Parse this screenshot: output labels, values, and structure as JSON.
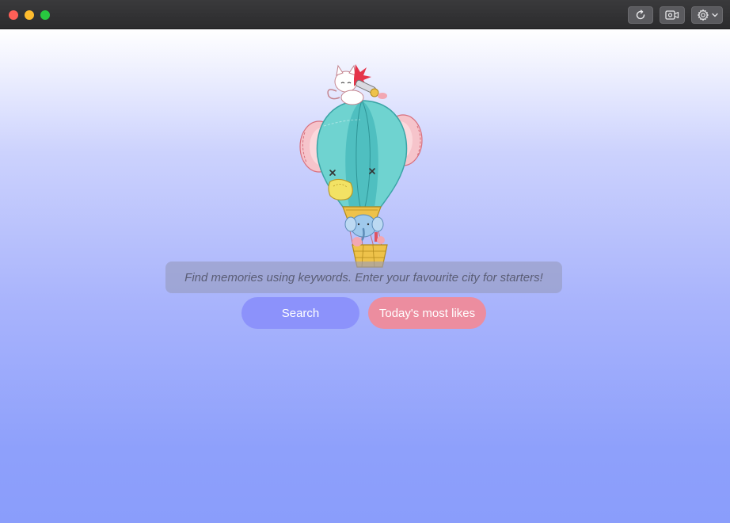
{
  "titlebar": {
    "traffic_lights": {
      "close": "#ff5f57",
      "minimize": "#febc2e",
      "zoom": "#28c840"
    },
    "buttons": [
      {
        "icon": "reload-icon"
      },
      {
        "icon": "record-video-icon"
      },
      {
        "icon": "gear-icon",
        "has_dropdown": true
      }
    ]
  },
  "main": {
    "illustration": "hot-air-balloon-elephant-cat",
    "search": {
      "placeholder": "Find memories using keywords. Enter your favourite city for starters!",
      "value": ""
    },
    "buttons": {
      "search_label": "Search",
      "likes_label": "Today's most likes"
    }
  },
  "colors": {
    "search_button": "#8c92fb",
    "likes_button": "#ec8d9f",
    "background_top": "#ffffff",
    "background_bottom": "#8a9dfb"
  }
}
